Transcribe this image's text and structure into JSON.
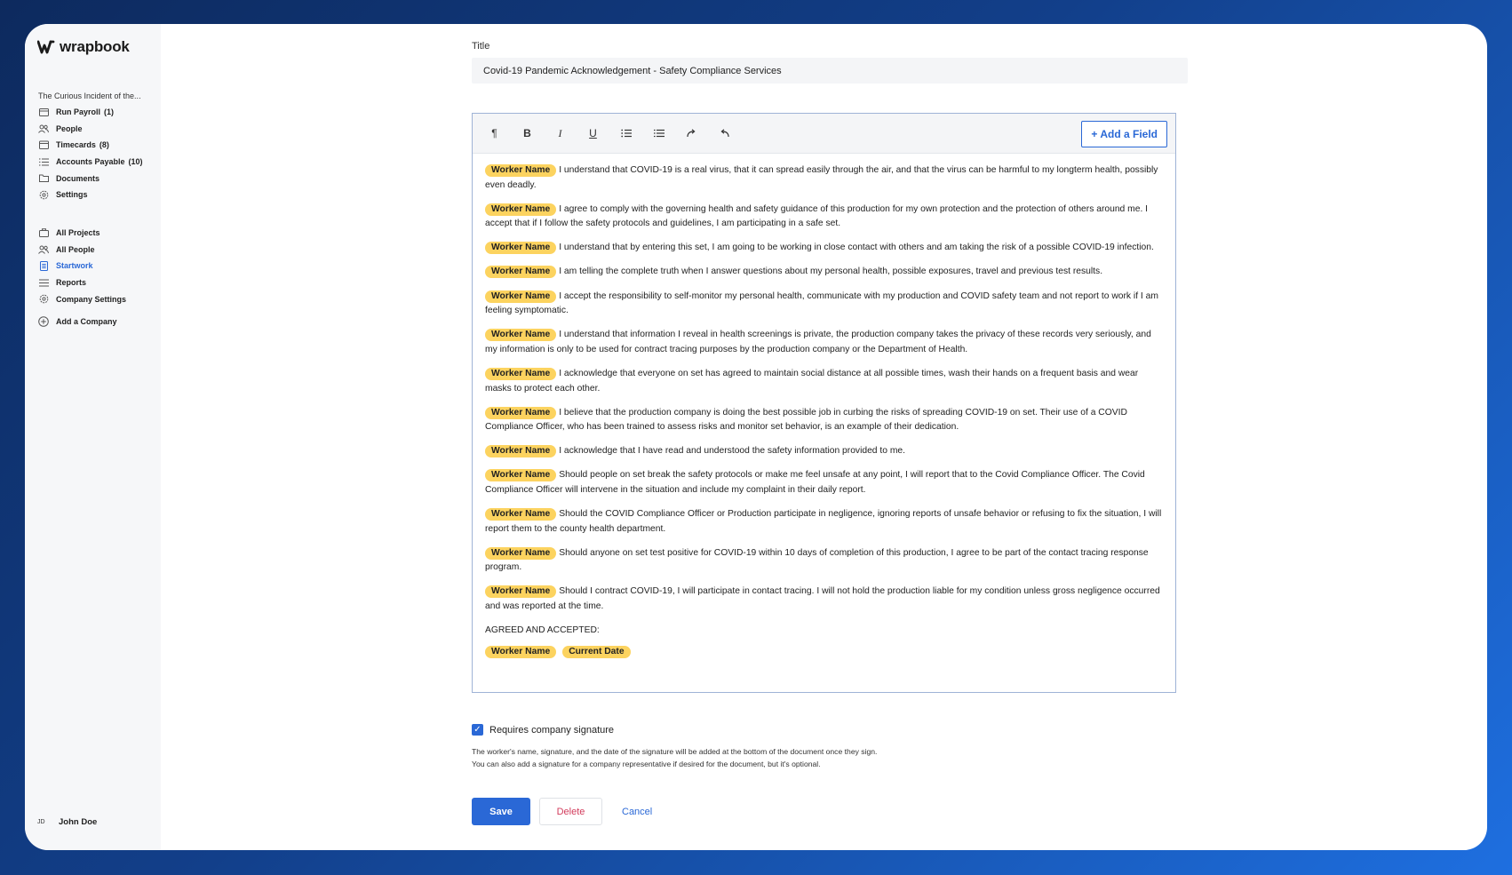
{
  "brand": {
    "name": "wrapbook"
  },
  "sidebar": {
    "project": "The Curious Incident of the...",
    "project_nav": [
      {
        "label": "Run Payroll",
        "count": "(1)",
        "icon": "card-icon"
      },
      {
        "label": "People",
        "count": "",
        "icon": "people-icon"
      },
      {
        "label": "Timecards",
        "count": "(8)",
        "icon": "calendar-icon"
      },
      {
        "label": "Accounts Payable",
        "count": "(10)",
        "icon": "list-icon"
      },
      {
        "label": "Documents",
        "count": "",
        "icon": "folder-icon"
      },
      {
        "label": "Settings",
        "count": "",
        "icon": "gear-icon"
      }
    ],
    "company_nav": [
      {
        "label": "All Projects",
        "icon": "briefcase-icon"
      },
      {
        "label": "All People",
        "icon": "people-icon"
      },
      {
        "label": "Startwork",
        "icon": "document-icon",
        "active": true
      },
      {
        "label": "Reports",
        "icon": "list-icon"
      },
      {
        "label": "Company Settings",
        "icon": "gear-icon"
      }
    ],
    "add_company": "Add a Company",
    "user": {
      "initials": "JD",
      "name": "John Doe"
    }
  },
  "form": {
    "title_label": "Title",
    "title_value": "Covid-19 Pandemic Acknowledgement - Safety Compliance Services",
    "add_field_label": "+ Add a Field",
    "toolbar": [
      "pilcrow-icon",
      "bold-icon",
      "italic-icon",
      "underline-icon",
      "ordered-list-icon",
      "bullet-list-icon",
      "redo-icon",
      "undo-icon"
    ],
    "worker_chip": "Worker Name",
    "date_chip": "Current Date",
    "paragraphs": [
      "I understand that COVID-19 is a real virus, that it can spread easily through the air, and that the virus can be harmful to my longterm health, possibly even deadly.",
      "I agree to comply with the governing health and safety guidance of this production for my own protection and the protection of others around me. I accept that if I follow the safety protocols and guidelines, I am participating in a safe set.",
      "I understand that by entering this set, I am going to be working in close contact with others and am taking the risk of a possible COVID-19 infection.",
      "I am telling the complete truth when I answer questions about my personal health, possible exposures, travel and previous test results.",
      "I accept the responsibility to self-monitor my personal health, communicate with my production and COVID safety team and not report to work if I am feeling symptomatic.",
      "I understand that information I reveal in health screenings is private, the production company takes the privacy of these records very seriously, and my information is only to be used for contract tracing purposes by the production company or the Department of Health.",
      "I acknowledge that everyone on set has agreed to maintain social distance at all possible times, wash their hands on a frequent basis and wear masks to protect each other.",
      "I believe that the production company is doing the best possible job in curbing the risks of spreading COVID-19 on set. Their use of a COVID Compliance Officer, who has been trained to assess risks and monitor set behavior, is an example of their dedication.",
      "I acknowledge that I have read and understood the safety information provided to me.",
      "Should people on set break the safety protocols or make me feel unsafe at any point, I will report that to the Covid Compliance Officer. The Covid Compliance Officer will intervene in the situation and include my complaint in their daily report.",
      "Should the COVID Compliance Officer or Production participate in negligence, ignoring reports of unsafe behavior or refusing to fix the situation, I will report them to the county health department.",
      "Should anyone on set test positive for COVID-19 within 10 days of completion of this production, I agree to be part of the contact tracing response program.",
      "Should I contract COVID-19, I will participate in contact tracing. I will not hold the production liable for my condition unless gross negligence occurred and was reported at the time."
    ],
    "agreed_text": "AGREED AND ACCEPTED:",
    "requires_signature_label": "Requires company signature",
    "requires_signature_checked": true,
    "help_line_1": "The worker's name, signature, and the date of the signature will be added at the bottom of the document once they sign.",
    "help_line_2": "You can also add a signature for a company representative if desired for the document, but it's optional.",
    "save_label": "Save",
    "delete_label": "Delete",
    "cancel_label": "Cancel"
  },
  "colors": {
    "accent": "#2a68d6",
    "chip": "#fcd35f",
    "danger": "#d23c5c"
  }
}
